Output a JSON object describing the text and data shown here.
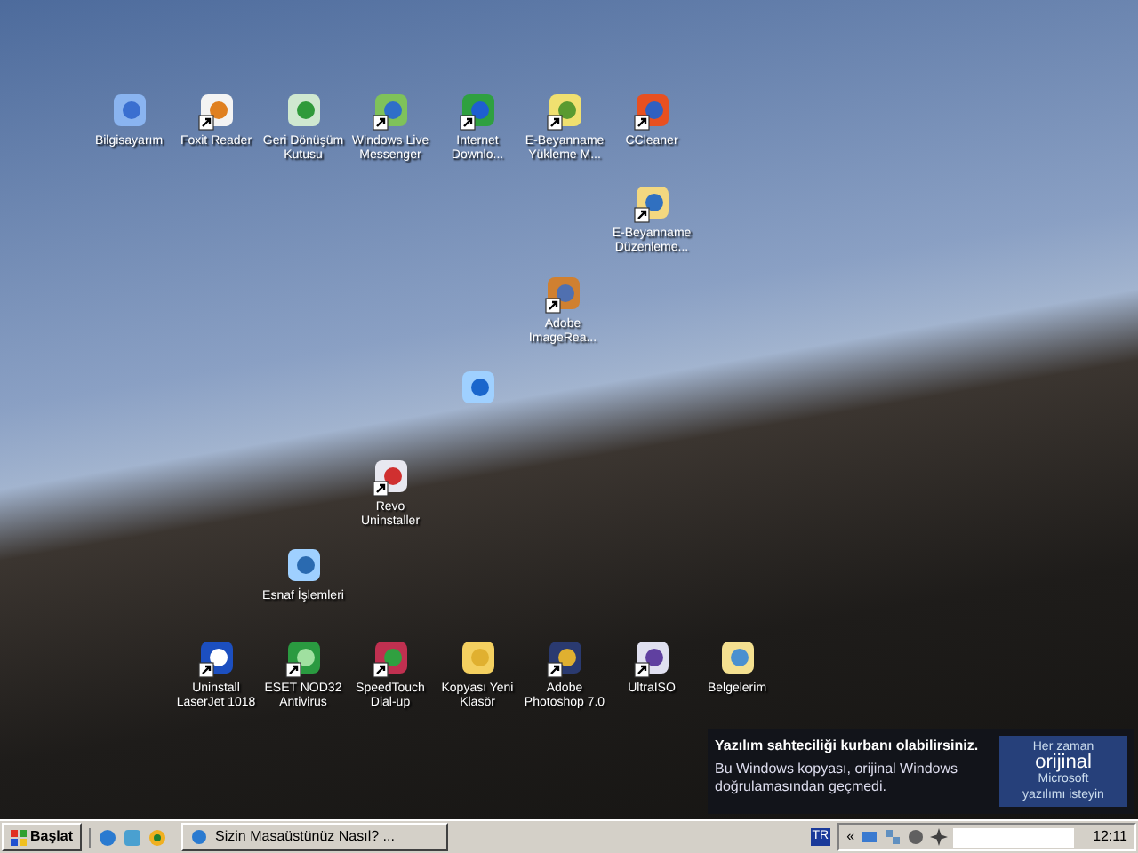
{
  "desktop_icons": [
    {
      "label": "Bilgisayarım",
      "shortcut": false
    },
    {
      "label": "Foxit Reader",
      "shortcut": true
    },
    {
      "label": "Geri Dönüşüm Kutusu",
      "shortcut": false
    },
    {
      "label": "Windows Live Messenger",
      "shortcut": true
    },
    {
      "label": "Internet Downlo...",
      "shortcut": true
    },
    {
      "label": "E-Beyanname Yükleme M...",
      "shortcut": true
    },
    {
      "label": "CCleaner",
      "shortcut": true
    },
    {
      "label": "E-Beyanname Düzenleme...",
      "shortcut": true
    },
    {
      "label": "Adobe ImageRea...",
      "shortcut": true
    },
    {
      "shortcut": false
    },
    {
      "label": "Revo Uninstaller",
      "shortcut": true
    },
    {
      "label": "Esnaf İşlemleri",
      "shortcut": false
    },
    {
      "label": "Uninstall LaserJet 1018",
      "shortcut": true
    },
    {
      "label": "ESET NOD32 Antivirus",
      "shortcut": true
    },
    {
      "label": "SpeedTouch Dial-up",
      "shortcut": true
    },
    {
      "label": "Kopyası Yeni Klasör",
      "shortcut": false
    },
    {
      "label": "Adobe Photoshop 7.0",
      "shortcut": true
    },
    {
      "label": "UltraISO",
      "shortcut": true
    },
    {
      "label": "Belgelerim",
      "shortcut": false
    }
  ],
  "notification": {
    "title": "Yazılım sahteciliği kurbanı olabilirsiniz.",
    "body": "Bu Windows kopyası, orijinal Windows doğrulamasından geçmedi.",
    "badge": [
      "Her zaman",
      "orijinal",
      "Microsoft",
      "yazılımı isteyin"
    ]
  },
  "taskbar": {
    "start": "Başlat",
    "task": "Sizin Masaüstünüz Nasıl? ...",
    "language": "TR",
    "expand": "«",
    "clock": "12:11"
  }
}
